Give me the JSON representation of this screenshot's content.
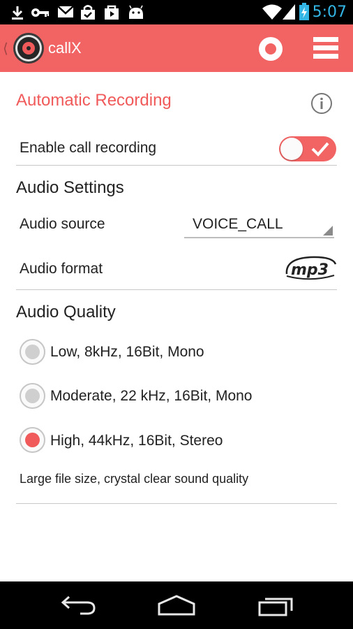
{
  "status_bar": {
    "time": "5:07",
    "icons": [
      "download-icon",
      "key-icon",
      "gmail-icon",
      "shopping-bag-icon",
      "play-store-icon",
      "android-icon",
      "wifi-icon",
      "signal-icon",
      "battery-charging-icon"
    ]
  },
  "action_bar": {
    "title": "callX",
    "icons": [
      "up-caret-icon",
      "app-logo-icon",
      "record-icon",
      "menu-icon"
    ]
  },
  "automatic_recording": {
    "title": "Automatic Recording",
    "info_icon": "info-icon",
    "enable_label": "Enable call recording",
    "enabled": true
  },
  "audio_settings": {
    "title": "Audio Settings",
    "source_label": "Audio source",
    "source_value": "VOICE_CALL",
    "format_label": "Audio format",
    "format_logo": "mp3"
  },
  "audio_quality": {
    "title": "Audio Quality",
    "options": [
      {
        "label": "Low, 8kHz, 16Bit, Mono",
        "selected": false
      },
      {
        "label": "Moderate, 22 kHz, 16Bit, Mono",
        "selected": false
      },
      {
        "label": "High, 44kHz, 16Bit, Stereo",
        "selected": true
      }
    ],
    "hint": "Large file size, crystal clear sound quality"
  },
  "colors": {
    "accent": "#f26464",
    "status_time": "#33b5e5"
  },
  "nav_bar": {
    "icons": [
      "back-icon",
      "home-icon",
      "recents-icon"
    ]
  }
}
